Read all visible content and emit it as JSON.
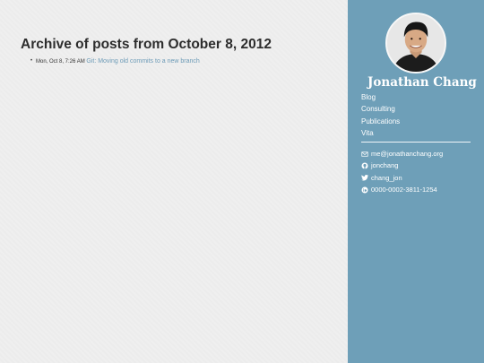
{
  "main": {
    "title": "Archive of posts from October 8, 2012",
    "posts": [
      {
        "date": "Mon, Oct 8, 7:26 AM",
        "title": "Git: Moving old commits to a new branch"
      }
    ]
  },
  "sidebar": {
    "name": "Jonathan Chang",
    "nav": [
      {
        "label": "Blog"
      },
      {
        "label": "Consulting"
      },
      {
        "label": "Publications"
      },
      {
        "label": "Vita"
      }
    ],
    "contacts": [
      {
        "icon": "mail-icon",
        "label": "me@jonathanchang.org"
      },
      {
        "icon": "github-icon",
        "label": "jonchang"
      },
      {
        "icon": "twitter-icon",
        "label": "chang_jon"
      },
      {
        "icon": "orcid-icon",
        "label": "0000-0002-3811-1254"
      }
    ]
  },
  "colors": {
    "sidebar_bg": "#6e9fb8",
    "link": "#6d9bb7",
    "title_text": "#2d2d2d"
  }
}
